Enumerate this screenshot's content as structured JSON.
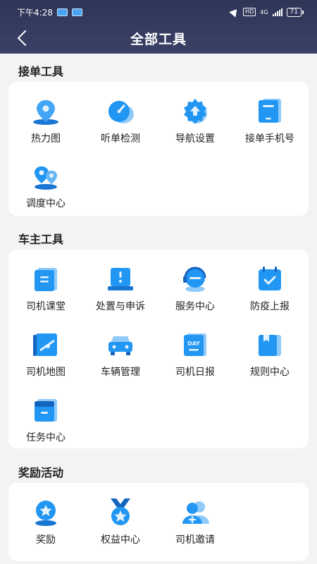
{
  "status_bar": {
    "time": "下午4:28",
    "hd": "HD",
    "network": "4G",
    "battery": "71"
  },
  "header": {
    "title": "全部工具"
  },
  "sections": [
    {
      "title": "接单工具",
      "items": [
        {
          "label": "热力图",
          "icon": "heatmap-icon"
        },
        {
          "label": "听单检测",
          "icon": "order-check-icon"
        },
        {
          "label": "导航设置",
          "icon": "navigation-settings-icon"
        },
        {
          "label": "接单手机号",
          "icon": "order-phone-icon"
        },
        {
          "label": "调度中心",
          "icon": "dispatch-center-icon"
        }
      ]
    },
    {
      "title": "车主工具",
      "items": [
        {
          "label": "司机课堂",
          "icon": "driver-class-icon"
        },
        {
          "label": "处置与申诉",
          "icon": "appeal-icon"
        },
        {
          "label": "服务中心",
          "icon": "service-center-icon"
        },
        {
          "label": "防疫上报",
          "icon": "epidemic-report-icon"
        },
        {
          "label": "司机地图",
          "icon": "driver-map-icon"
        },
        {
          "label": "车辆管理",
          "icon": "vehicle-management-icon"
        },
        {
          "label": "司机日报",
          "icon": "driver-daily-icon"
        },
        {
          "label": "规则中心",
          "icon": "rules-center-icon"
        },
        {
          "label": "任务中心",
          "icon": "task-center-icon"
        }
      ]
    },
    {
      "title": "奖励活动",
      "items": [
        {
          "label": "奖励",
          "icon": "reward-icon"
        },
        {
          "label": "权益中心",
          "icon": "benefits-center-icon"
        },
        {
          "label": "司机邀请",
          "icon": "driver-invite-icon"
        }
      ]
    }
  ],
  "icon_texts": {
    "day": "DAY"
  },
  "colors": {
    "header_bg": "#2e3557",
    "icon_primary": "#2196f3",
    "icon_light": "#7cc3f7",
    "page_bg": "#f2f3f5"
  }
}
